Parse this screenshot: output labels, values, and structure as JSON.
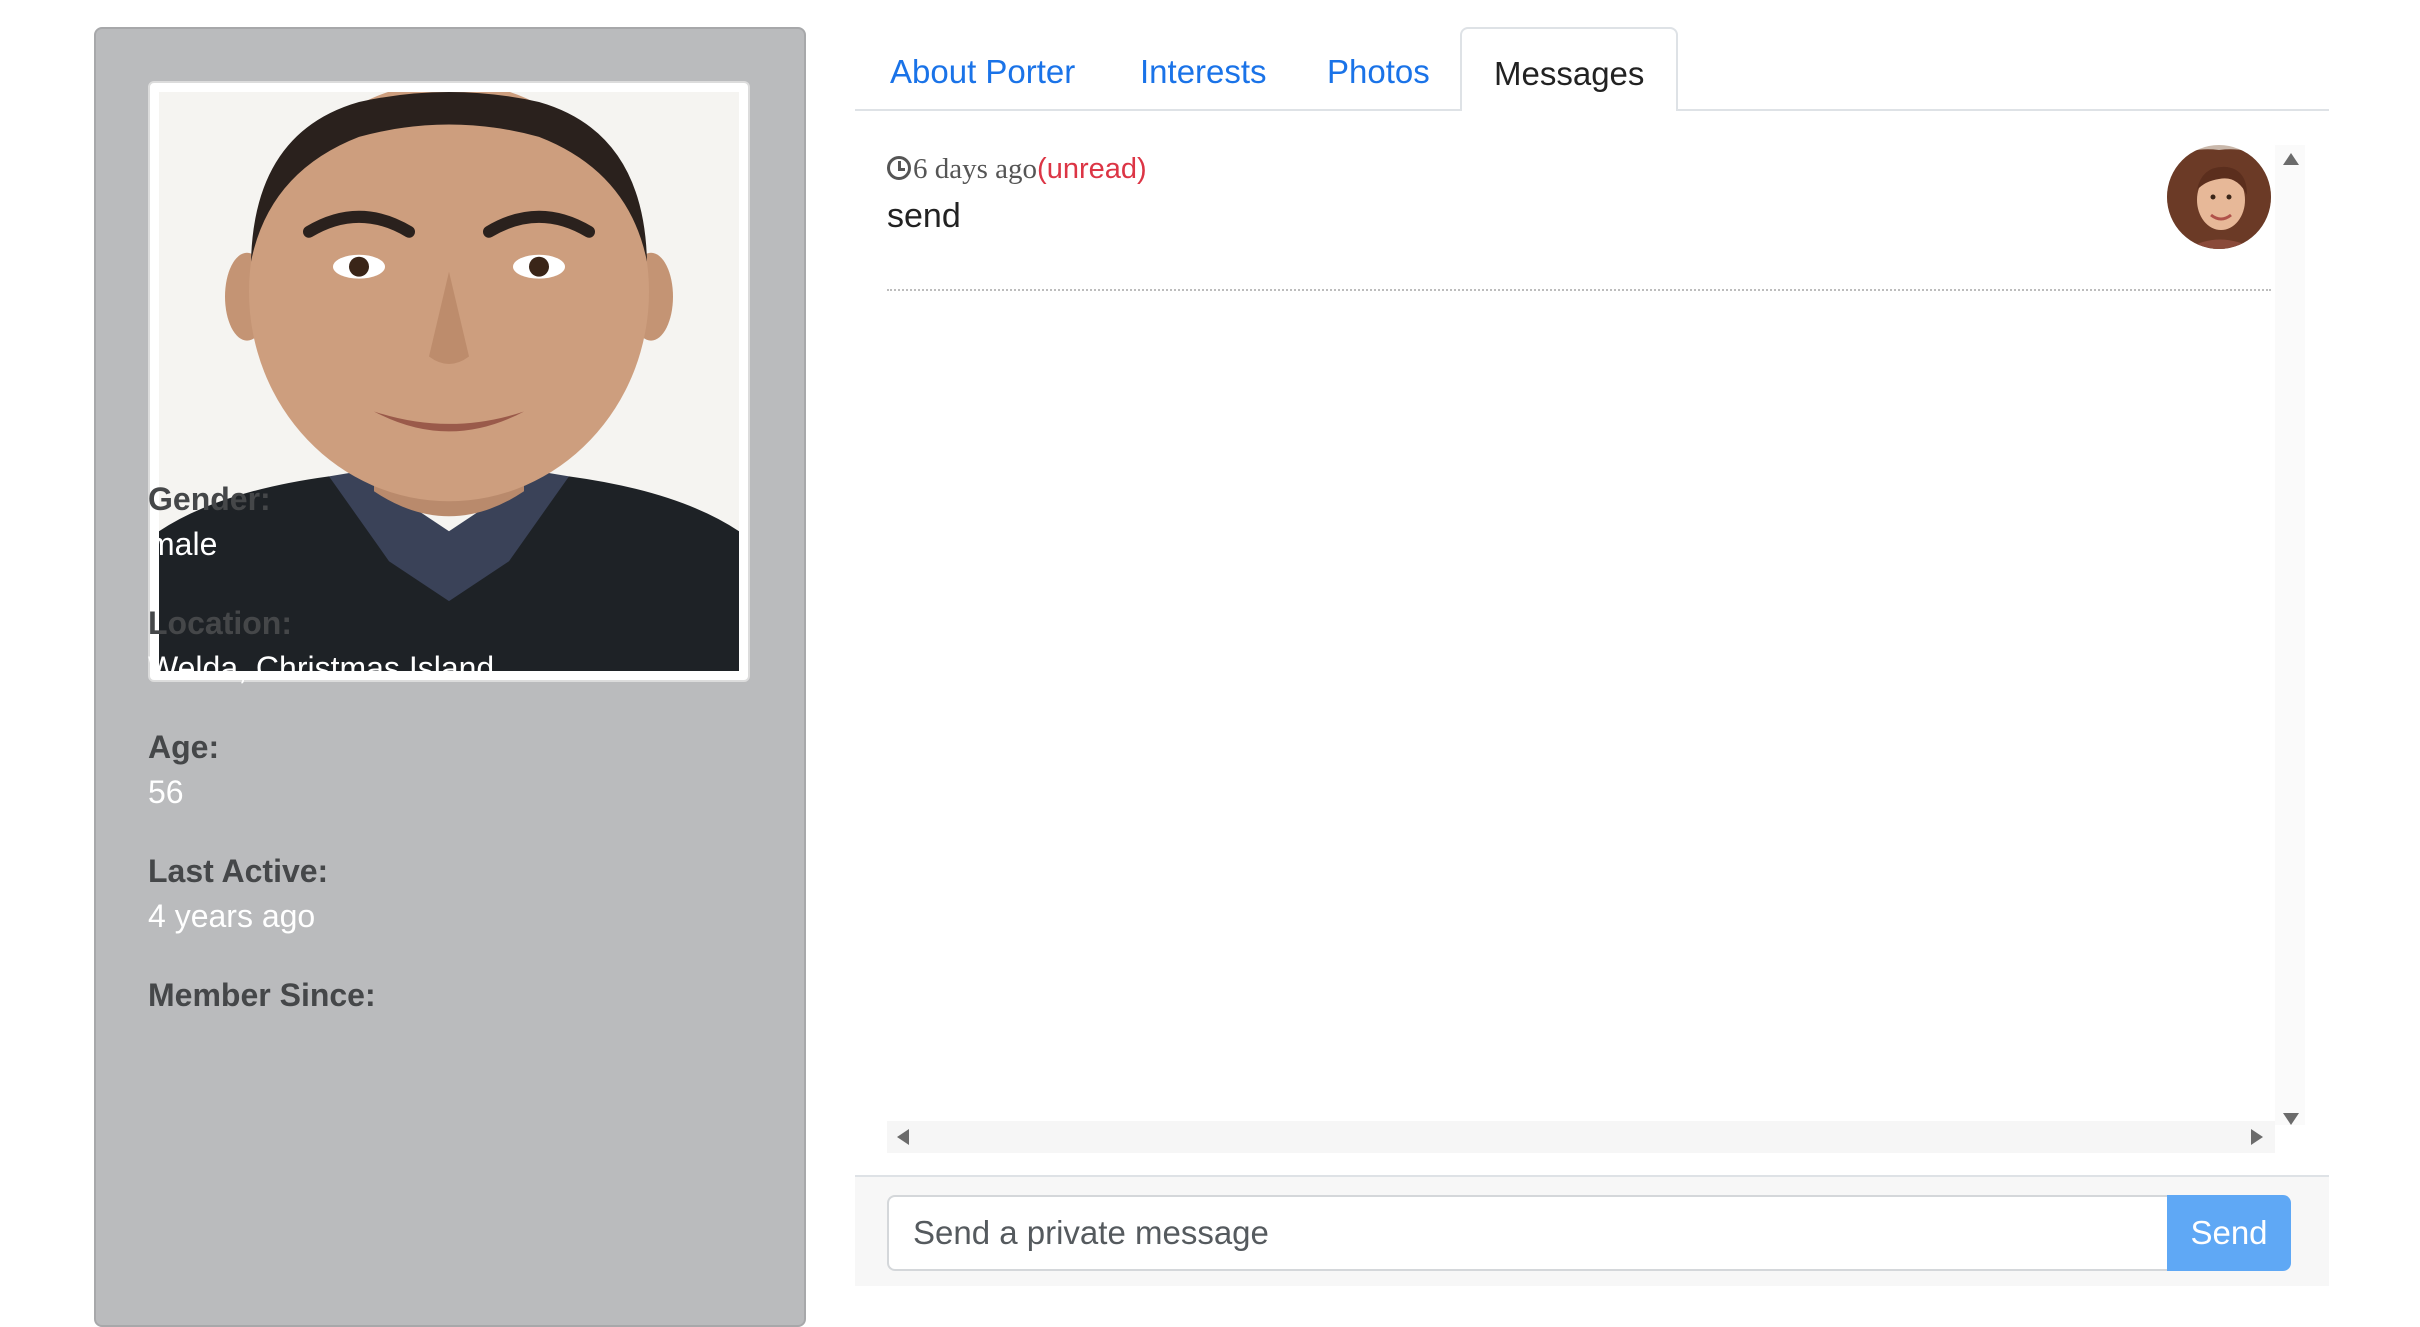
{
  "profile": {
    "photo_alt": "profile photo",
    "fields": [
      {
        "label": "Gender:",
        "value": "male"
      },
      {
        "label": "Location:",
        "value": "Welda, Christmas Island"
      },
      {
        "label": "Age:",
        "value": "56"
      },
      {
        "label": "Last Active:",
        "value": "4 years ago"
      },
      {
        "label": "Member Since:",
        "value": ""
      }
    ]
  },
  "tabs": [
    {
      "label": "About Porter",
      "active": false
    },
    {
      "label": "Interests",
      "active": false
    },
    {
      "label": "Photos",
      "active": false
    },
    {
      "label": "Messages",
      "active": true
    }
  ],
  "messages": [
    {
      "time": "6 days ago",
      "status": "(unread)",
      "body": "send",
      "avatar_icon": "sender-avatar"
    }
  ],
  "composer": {
    "placeholder": "Send a private message",
    "value": "",
    "send_label": "Send"
  },
  "colors": {
    "card_bg": "#babbbd",
    "link": "#1a73e8",
    "unread": "#dc3545",
    "send_button": "#5fa8f5"
  },
  "icons": {
    "clock": "clock-icon",
    "scroll_up": "arrow-up-icon",
    "scroll_down": "arrow-down-icon",
    "scroll_left": "arrow-left-icon",
    "scroll_right": "arrow-right-icon"
  }
}
